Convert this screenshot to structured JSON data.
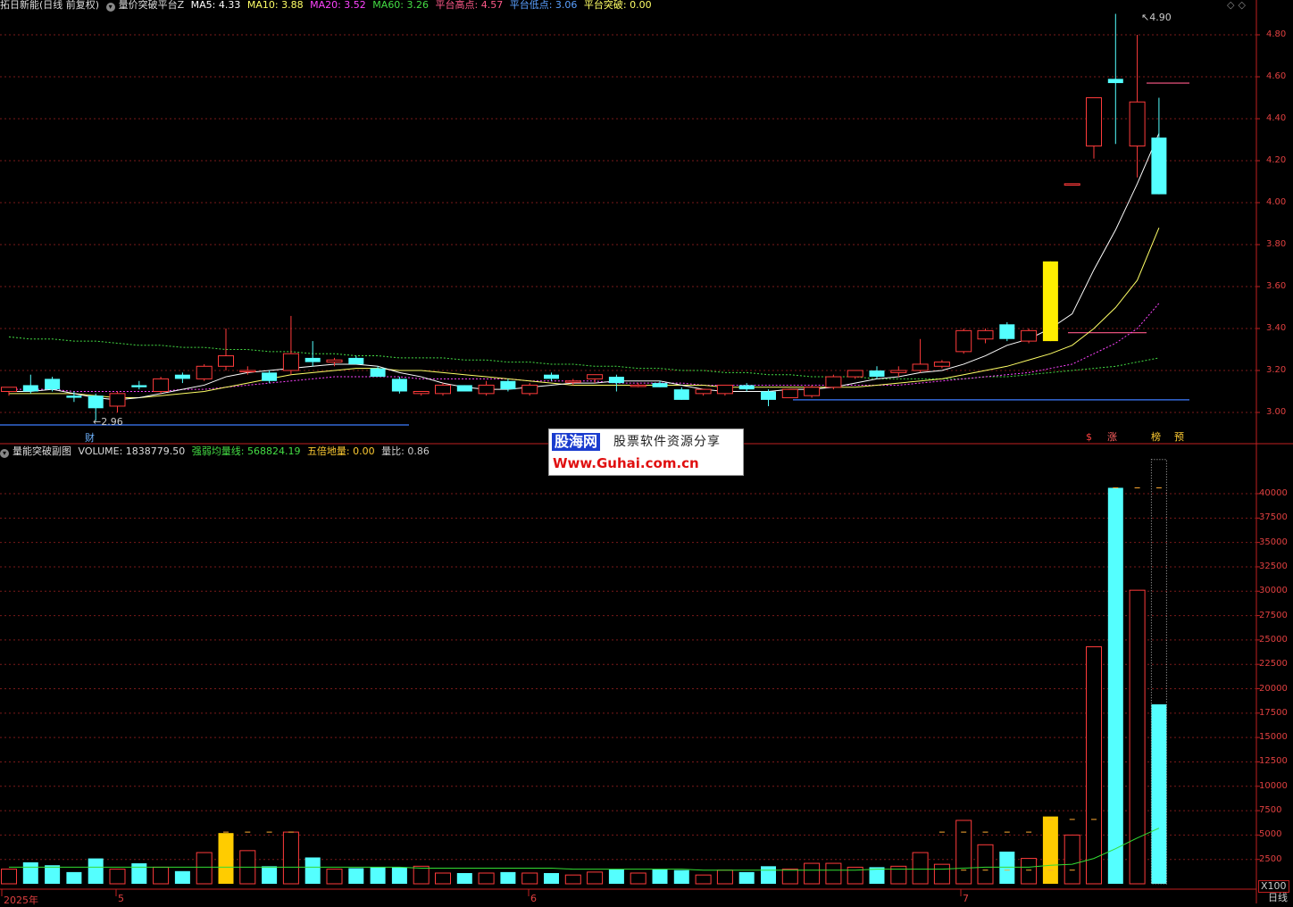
{
  "header_top": {
    "stock": "拓日新能(日线 前复权)",
    "indicator": "量价突破平台Z",
    "ma5": "MA5: 4.33",
    "ma10": "MA10: 3.88",
    "ma20": "MA20: 3.52",
    "ma60": "MA60: 3.26",
    "high": "平台高点: 4.57",
    "low": "平台低点: 3.06",
    "breakout": "平台突破: 0.00"
  },
  "header_bottom": {
    "indicator": "量能突破副图",
    "volume": "VOLUME: 1838779.50",
    "avg": "强弱均量线: 568824.19",
    "five": "五倍地量: 0.00",
    "ratio": "量比: 0.86"
  },
  "price_axis": [
    "4.80",
    "4.60",
    "4.40",
    "4.20",
    "4.00",
    "3.80",
    "3.60",
    "3.40",
    "3.20",
    "3.00"
  ],
  "volume_axis": [
    "40000",
    "37500",
    "35000",
    "32500",
    "30000",
    "27500",
    "25000",
    "22500",
    "20000",
    "17500",
    "15000",
    "12500",
    "10000",
    "7500",
    "5000",
    "2500"
  ],
  "x_axis": [
    "2025年",
    "5",
    "6",
    "7"
  ],
  "labels": {
    "peak": "4.90",
    "trough": "2.96",
    "cai": "财",
    "dollar": "$",
    "zhang": "涨",
    "bang": "榜",
    "yu": "预",
    "unit": "X100",
    "period": "日线"
  },
  "watermark": {
    "brand": "股海网",
    "slogan": "股票软件资源分享",
    "url": "Www.Guhai.com.cn"
  },
  "colors": {
    "up": "#ff3b3b",
    "down": "#54ffff",
    "ma5": "#ffffff",
    "ma10": "#ffff66",
    "ma20": "#ff44ff",
    "ma60": "#44dd44",
    "axis": "#c02020",
    "volume_avg": "#33dd33"
  },
  "chart_data": {
    "type": "candlestick",
    "price_range": [
      2.96,
      4.9
    ],
    "volume_range": [
      0,
      42000
    ],
    "candles": [
      [
        3.1,
        3.12,
        3.08,
        3.12
      ],
      [
        3.13,
        3.18,
        3.09,
        3.1
      ],
      [
        3.16,
        3.17,
        3.1,
        3.11
      ],
      [
        3.08,
        3.1,
        3.05,
        3.07
      ],
      [
        3.08,
        3.09,
        2.96,
        3.02
      ],
      [
        3.03,
        3.1,
        3.0,
        3.09
      ],
      [
        3.13,
        3.15,
        3.11,
        3.12
      ],
      [
        3.1,
        3.17,
        3.09,
        3.16
      ],
      [
        3.18,
        3.19,
        3.14,
        3.16
      ],
      [
        3.16,
        3.23,
        3.15,
        3.22
      ],
      [
        3.22,
        3.4,
        3.2,
        3.27
      ],
      [
        3.2,
        3.22,
        3.18,
        3.2
      ],
      [
        3.19,
        3.2,
        3.14,
        3.15
      ],
      [
        3.2,
        3.46,
        3.18,
        3.28
      ],
      [
        3.26,
        3.34,
        3.22,
        3.24
      ],
      [
        3.24,
        3.26,
        3.22,
        3.25
      ],
      [
        3.26,
        3.27,
        3.23,
        3.23
      ],
      [
        3.21,
        3.22,
        3.17,
        3.17
      ],
      [
        3.16,
        3.17,
        3.09,
        3.1
      ],
      [
        3.09,
        3.1,
        3.08,
        3.1
      ],
      [
        3.09,
        3.14,
        3.08,
        3.13
      ],
      [
        3.13,
        3.13,
        3.1,
        3.1
      ],
      [
        3.09,
        3.15,
        3.08,
        3.13
      ],
      [
        3.15,
        3.16,
        3.1,
        3.11
      ],
      [
        3.09,
        3.14,
        3.08,
        3.13
      ],
      [
        3.18,
        3.19,
        3.15,
        3.16
      ],
      [
        3.15,
        3.16,
        3.13,
        3.15
      ],
      [
        3.16,
        3.18,
        3.14,
        3.18
      ],
      [
        3.17,
        3.18,
        3.1,
        3.14
      ],
      [
        3.13,
        3.14,
        3.12,
        3.13
      ],
      [
        3.14,
        3.15,
        3.12,
        3.12
      ],
      [
        3.11,
        3.12,
        3.06,
        3.06
      ],
      [
        3.09,
        3.11,
        3.08,
        3.11
      ],
      [
        3.09,
        3.13,
        3.08,
        3.13
      ],
      [
        3.13,
        3.14,
        3.1,
        3.11
      ],
      [
        3.1,
        3.11,
        3.03,
        3.06
      ],
      [
        3.07,
        3.11,
        3.07,
        3.11
      ],
      [
        3.08,
        3.13,
        3.07,
        3.12
      ],
      [
        3.12,
        3.18,
        3.11,
        3.17
      ],
      [
        3.17,
        3.2,
        3.16,
        3.2
      ],
      [
        3.2,
        3.22,
        3.16,
        3.17
      ],
      [
        3.19,
        3.22,
        3.17,
        3.2
      ],
      [
        3.2,
        3.35,
        3.19,
        3.23
      ],
      [
        3.22,
        3.25,
        3.21,
        3.24
      ],
      [
        3.29,
        3.4,
        3.28,
        3.39
      ],
      [
        3.35,
        3.4,
        3.33,
        3.39
      ],
      [
        3.42,
        3.43,
        3.34,
        3.35
      ],
      [
        3.34,
        3.4,
        3.33,
        3.39
      ],
      [
        3.34,
        3.72,
        3.34,
        3.72
      ],
      [
        4.09,
        4.09,
        4.09,
        4.09
      ],
      [
        4.27,
        4.5,
        4.21,
        4.5
      ],
      [
        4.59,
        4.9,
        4.28,
        4.57
      ],
      [
        4.27,
        4.8,
        4.12,
        4.48
      ],
      [
        4.31,
        4.5,
        4.04,
        4.04
      ]
    ],
    "volumes": [
      1500,
      2200,
      1900,
      1200,
      2600,
      1500,
      2100,
      1700,
      1300,
      3200,
      5200,
      3400,
      1800,
      5300,
      2700,
      1500,
      1600,
      1700,
      1700,
      1800,
      1100,
      1100,
      1100,
      1200,
      1100,
      1100,
      900,
      1200,
      1500,
      1100,
      1500,
      1400,
      900,
      1400,
      1200,
      1800,
      1500,
      2100,
      2100,
      1700,
      1700,
      1800,
      3200,
      2000,
      6500,
      4000,
      3300,
      2600,
      6900,
      5000,
      24300,
      40600,
      30100,
      18400
    ],
    "breakout_volume_index": [
      10,
      48
    ],
    "ma5": [
      3.1,
      3.1,
      3.11,
      3.09,
      3.07,
      3.06,
      3.07,
      3.09,
      3.11,
      3.13,
      3.17,
      3.19,
      3.2,
      3.21,
      3.22,
      3.23,
      3.23,
      3.22,
      3.19,
      3.17,
      3.14,
      3.12,
      3.11,
      3.11,
      3.12,
      3.13,
      3.14,
      3.14,
      3.15,
      3.15,
      3.15,
      3.13,
      3.11,
      3.1,
      3.1,
      3.1,
      3.11,
      3.11,
      3.12,
      3.14,
      3.16,
      3.17,
      3.19,
      3.2,
      3.23,
      3.27,
      3.32,
      3.35,
      3.4,
      3.47,
      3.68,
      3.87,
      4.09,
      4.33
    ],
    "ma10": [
      3.09,
      3.09,
      3.09,
      3.09,
      3.08,
      3.07,
      3.07,
      3.08,
      3.09,
      3.1,
      3.12,
      3.14,
      3.16,
      3.18,
      3.19,
      3.2,
      3.21,
      3.21,
      3.2,
      3.2,
      3.19,
      3.18,
      3.17,
      3.16,
      3.15,
      3.14,
      3.13,
      3.13,
      3.13,
      3.13,
      3.13,
      3.13,
      3.13,
      3.12,
      3.12,
      3.12,
      3.12,
      3.12,
      3.12,
      3.12,
      3.13,
      3.14,
      3.15,
      3.16,
      3.18,
      3.2,
      3.22,
      3.25,
      3.28,
      3.32,
      3.4,
      3.5,
      3.63,
      3.88
    ],
    "ma20": [
      3.11,
      3.11,
      3.11,
      3.1,
      3.1,
      3.1,
      3.1,
      3.1,
      3.11,
      3.11,
      3.12,
      3.13,
      3.14,
      3.15,
      3.16,
      3.17,
      3.17,
      3.17,
      3.17,
      3.16,
      3.16,
      3.16,
      3.16,
      3.16,
      3.15,
      3.15,
      3.15,
      3.15,
      3.14,
      3.14,
      3.14,
      3.14,
      3.13,
      3.13,
      3.13,
      3.13,
      3.13,
      3.13,
      3.13,
      3.13,
      3.13,
      3.13,
      3.14,
      3.15,
      3.16,
      3.17,
      3.18,
      3.19,
      3.21,
      3.23,
      3.28,
      3.33,
      3.4,
      3.52
    ],
    "ma60": [
      3.36,
      3.35,
      3.35,
      3.34,
      3.34,
      3.33,
      3.32,
      3.32,
      3.31,
      3.31,
      3.3,
      3.3,
      3.29,
      3.29,
      3.28,
      3.28,
      3.27,
      3.27,
      3.26,
      3.26,
      3.26,
      3.25,
      3.25,
      3.24,
      3.24,
      3.23,
      3.23,
      3.22,
      3.22,
      3.21,
      3.21,
      3.2,
      3.2,
      3.19,
      3.19,
      3.18,
      3.18,
      3.17,
      3.17,
      3.17,
      3.16,
      3.16,
      3.16,
      3.16,
      3.16,
      3.17,
      3.17,
      3.18,
      3.19,
      3.2,
      3.21,
      3.22,
      3.24,
      3.26
    ],
    "volume_avg": [
      1700,
      1700,
      1700,
      1700,
      1700,
      1700,
      1700,
      1700,
      1700,
      1700,
      1700,
      1700,
      1700,
      1700,
      1700,
      1700,
      1700,
      1700,
      1700,
      1600,
      1600,
      1600,
      1600,
      1600,
      1600,
      1600,
      1500,
      1500,
      1500,
      1500,
      1500,
      1500,
      1400,
      1400,
      1400,
      1400,
      1400,
      1400,
      1400,
      1400,
      1500,
      1500,
      1500,
      1500,
      1600,
      1700,
      1700,
      1700,
      1900,
      2000,
      2600,
      3600,
      4700,
      5700
    ],
    "platform_high": 3.38,
    "platform_low": 3.06,
    "top_line": 4.57
  }
}
